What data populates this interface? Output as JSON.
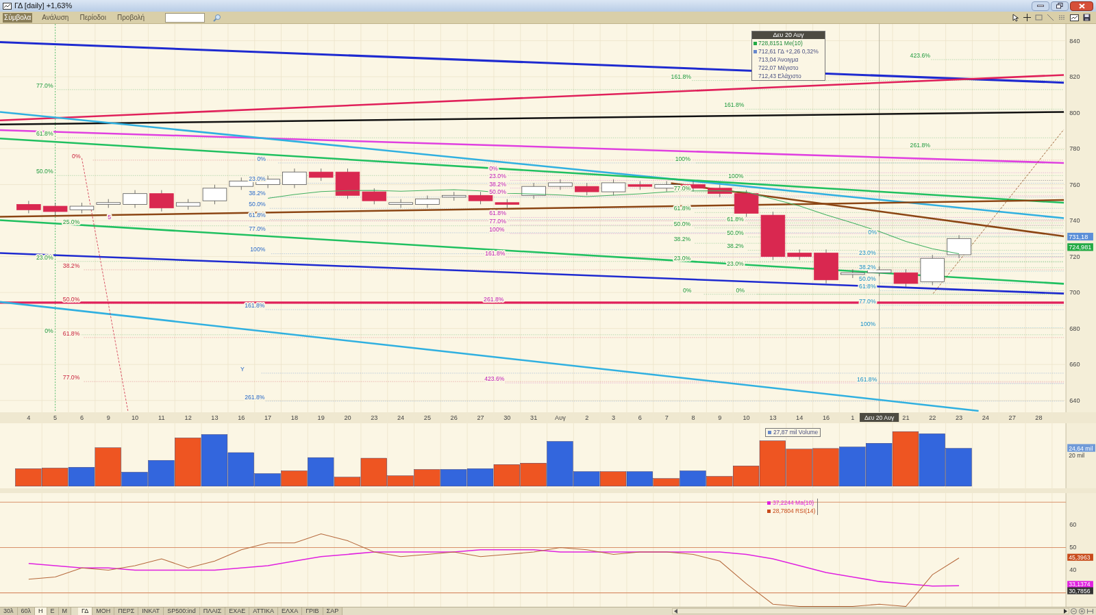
{
  "window": {
    "title": "ΓΔ [daily] +1,63%"
  },
  "menu": [
    {
      "label": "Σύμβολα",
      "selected": true
    },
    {
      "label": "Ανάλυση",
      "selected": false
    },
    {
      "label": "Περίοδοι",
      "selected": false
    },
    {
      "label": "Προβολή",
      "selected": false
    }
  ],
  "price_pane": {
    "tooltip": {
      "title": "Δευ 20 Αυγ",
      "rows": [
        {
          "text": "728,8151 Me(10)",
          "color": "#22aa44"
        },
        {
          "text": "712,61 ΓΔ +2,26 0,32%",
          "color": "#6688cc"
        },
        {
          "text": "713,04 Άνοιγμα"
        },
        {
          "text": "722,07 Μέγιστο"
        },
        {
          "text": "712,43 Ελάχιστο"
        }
      ]
    },
    "axis_labels": [
      "840",
      "820",
      "800",
      "780",
      "760",
      "740",
      "720",
      "700",
      "680",
      "660",
      "640"
    ],
    "markers": [
      {
        "text": "731,18",
        "color": "#5b8fd8"
      },
      {
        "text": "724,981",
        "color": "#22aa44"
      }
    ],
    "fib_sets": [
      {
        "labels": [
          "423.6%",
          "161.8%",
          "161.8%",
          "261.8%",
          "77.0%",
          "61.8%",
          "50.0%",
          "25.0%",
          "23.0%",
          "0%"
        ]
      },
      {
        "labels": [
          "0%",
          "38.2%",
          "50.0%",
          "61.8%",
          "77.0%"
        ]
      },
      {
        "labels": [
          "0%",
          "23.0%",
          "38.2%",
          "50.0%",
          "61.8%",
          "77.0%",
          "100%",
          "161.8%",
          "261.8%",
          "Y"
        ]
      },
      {
        "labels": [
          "0%",
          "23.0%",
          "38.2%",
          "50.0%",
          "61.8%",
          "77.0%",
          "100%",
          "161.8%",
          "261.8%",
          "423.6%",
          "5"
        ]
      },
      {
        "labels": [
          "100%",
          "77.0%",
          "61.8%",
          "50.0%",
          "38.2%",
          "23.0%",
          "0%"
        ]
      },
      {
        "labels": [
          "100%",
          "61.8%",
          "50.0%",
          "38.2%",
          "23.0%",
          "0%"
        ]
      },
      {
        "labels": [
          "0%",
          "23.0%",
          "38.2%",
          "50.0%",
          "61.8%",
          "77.0%",
          "100%",
          "161.8%"
        ]
      }
    ]
  },
  "x_axis": [
    {
      "text": "4",
      "kind": "tick"
    },
    {
      "text": "5",
      "kind": "tick"
    },
    {
      "text": "6",
      "kind": "tick"
    },
    {
      "text": "9",
      "kind": "tick"
    },
    {
      "text": "10",
      "kind": "tick"
    },
    {
      "text": "11",
      "kind": "tick"
    },
    {
      "text": "12",
      "kind": "tick"
    },
    {
      "text": "13",
      "kind": "tick"
    },
    {
      "text": "16",
      "kind": "tick"
    },
    {
      "text": "17",
      "kind": "tick"
    },
    {
      "text": "18",
      "kind": "tick"
    },
    {
      "text": "19",
      "kind": "tick"
    },
    {
      "text": "20",
      "kind": "tick"
    },
    {
      "text": "23",
      "kind": "tick"
    },
    {
      "text": "24",
      "kind": "tick"
    },
    {
      "text": "25",
      "kind": "tick"
    },
    {
      "text": "26",
      "kind": "tick"
    },
    {
      "text": "27",
      "kind": "tick"
    },
    {
      "text": "30",
      "kind": "tick"
    },
    {
      "text": "31",
      "kind": "tick"
    },
    {
      "text": "Αυγ",
      "kind": "tick"
    },
    {
      "text": "2",
      "kind": "tick"
    },
    {
      "text": "3",
      "kind": "tick"
    },
    {
      "text": "6",
      "kind": "tick"
    },
    {
      "text": "7",
      "kind": "tick"
    },
    {
      "text": "8",
      "kind": "tick"
    },
    {
      "text": "9",
      "kind": "tick"
    },
    {
      "text": "10",
      "kind": "tick"
    },
    {
      "text": "13",
      "kind": "tick"
    },
    {
      "text": "14",
      "kind": "tick"
    },
    {
      "text": "16",
      "kind": "tick"
    },
    {
      "text": "1",
      "kind": "tick"
    },
    {
      "text": "Δευ 20 Αυγ",
      "kind": "cursor"
    },
    {
      "text": "21",
      "kind": "tick"
    },
    {
      "text": "22",
      "kind": "tick"
    },
    {
      "text": "23",
      "kind": "tick"
    },
    {
      "text": "24",
      "kind": "tick"
    },
    {
      "text": "27",
      "kind": "tick"
    },
    {
      "text": "28",
      "kind": "tick"
    }
  ],
  "volume_pane": {
    "legend": {
      "text": "27,87 mil Volume",
      "color": "#6688cc"
    },
    "axis_labels": [
      "20 mil"
    ],
    "marker": {
      "text": "24,64 mil",
      "color": "#6f9ad8"
    }
  },
  "rsi_pane": {
    "legend": [
      {
        "text": "37,2244 Ma(10)",
        "color": "#e020e0"
      },
      {
        "text": "28,7804 RSI(14)",
        "color": "#c84a1a"
      }
    ],
    "axis_labels": [
      "60",
      "50",
      "40"
    ],
    "markers": [
      {
        "text": "45,3963",
        "color": "#c84a1a"
      },
      {
        "text": "33,1374",
        "color": "#e020e0"
      },
      {
        "text": "30,7856",
        "color": "#333333"
      }
    ]
  },
  "bottom_tabs": {
    "periods": [
      {
        "label": "30λ",
        "selected": false
      },
      {
        "label": "60λ",
        "selected": false
      },
      {
        "label": "Η",
        "selected": true
      },
      {
        "label": "Ε",
        "selected": false
      },
      {
        "label": "Μ",
        "selected": false
      }
    ],
    "symbols": [
      {
        "label": "ΓΔ",
        "selected": true
      },
      {
        "label": "ΜΟΗ",
        "selected": false
      },
      {
        "label": "ΠΕΡΣ",
        "selected": false
      },
      {
        "label": "ΙΝΚΑΤ",
        "selected": false
      },
      {
        "label": "SP500:ind",
        "selected": false
      },
      {
        "label": "ΠΛΑΙΣ",
        "selected": false
      },
      {
        "label": "ΕΧΑΕ",
        "selected": false
      },
      {
        "label": "ΑΤΤΙΚΑ",
        "selected": false
      },
      {
        "label": "ΕΛΧΑ",
        "selected": false
      },
      {
        "label": "ΓΡΙΒ",
        "selected": false
      },
      {
        "label": "ΣΑΡ",
        "selected": false
      }
    ]
  }
}
